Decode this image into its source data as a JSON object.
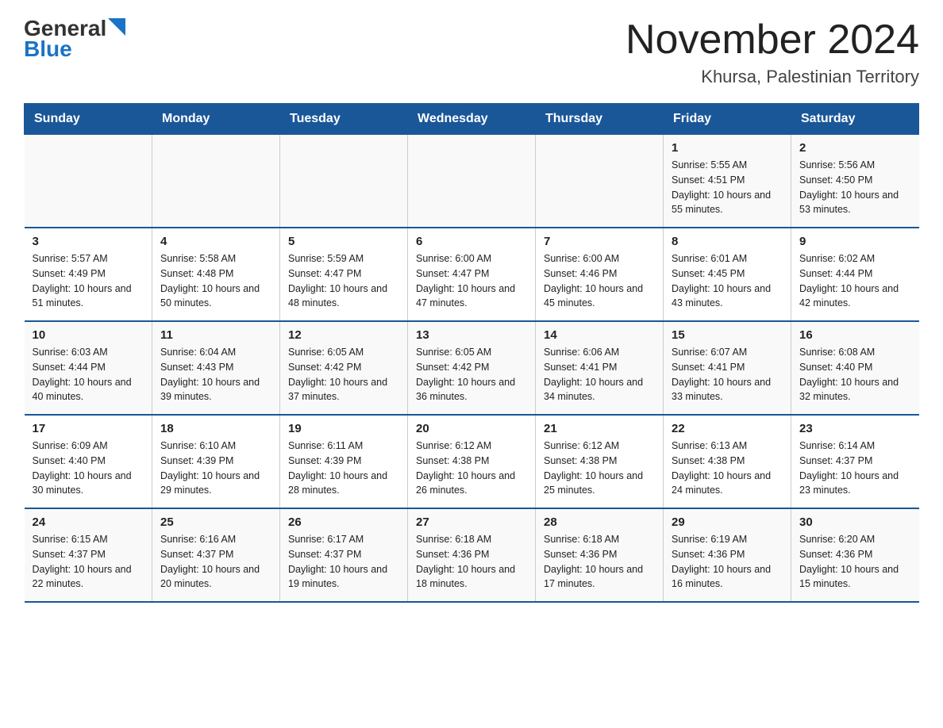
{
  "header": {
    "logo_line1": "General",
    "logo_line2": "Blue",
    "title": "November 2024",
    "subtitle": "Khursa, Palestinian Territory"
  },
  "days_of_week": [
    "Sunday",
    "Monday",
    "Tuesday",
    "Wednesday",
    "Thursday",
    "Friday",
    "Saturday"
  ],
  "weeks": [
    [
      {
        "day": "",
        "info": ""
      },
      {
        "day": "",
        "info": ""
      },
      {
        "day": "",
        "info": ""
      },
      {
        "day": "",
        "info": ""
      },
      {
        "day": "",
        "info": ""
      },
      {
        "day": "1",
        "info": "Sunrise: 5:55 AM\nSunset: 4:51 PM\nDaylight: 10 hours and 55 minutes."
      },
      {
        "day": "2",
        "info": "Sunrise: 5:56 AM\nSunset: 4:50 PM\nDaylight: 10 hours and 53 minutes."
      }
    ],
    [
      {
        "day": "3",
        "info": "Sunrise: 5:57 AM\nSunset: 4:49 PM\nDaylight: 10 hours and 51 minutes."
      },
      {
        "day": "4",
        "info": "Sunrise: 5:58 AM\nSunset: 4:48 PM\nDaylight: 10 hours and 50 minutes."
      },
      {
        "day": "5",
        "info": "Sunrise: 5:59 AM\nSunset: 4:47 PM\nDaylight: 10 hours and 48 minutes."
      },
      {
        "day": "6",
        "info": "Sunrise: 6:00 AM\nSunset: 4:47 PM\nDaylight: 10 hours and 47 minutes."
      },
      {
        "day": "7",
        "info": "Sunrise: 6:00 AM\nSunset: 4:46 PM\nDaylight: 10 hours and 45 minutes."
      },
      {
        "day": "8",
        "info": "Sunrise: 6:01 AM\nSunset: 4:45 PM\nDaylight: 10 hours and 43 minutes."
      },
      {
        "day": "9",
        "info": "Sunrise: 6:02 AM\nSunset: 4:44 PM\nDaylight: 10 hours and 42 minutes."
      }
    ],
    [
      {
        "day": "10",
        "info": "Sunrise: 6:03 AM\nSunset: 4:44 PM\nDaylight: 10 hours and 40 minutes."
      },
      {
        "day": "11",
        "info": "Sunrise: 6:04 AM\nSunset: 4:43 PM\nDaylight: 10 hours and 39 minutes."
      },
      {
        "day": "12",
        "info": "Sunrise: 6:05 AM\nSunset: 4:42 PM\nDaylight: 10 hours and 37 minutes."
      },
      {
        "day": "13",
        "info": "Sunrise: 6:05 AM\nSunset: 4:42 PM\nDaylight: 10 hours and 36 minutes."
      },
      {
        "day": "14",
        "info": "Sunrise: 6:06 AM\nSunset: 4:41 PM\nDaylight: 10 hours and 34 minutes."
      },
      {
        "day": "15",
        "info": "Sunrise: 6:07 AM\nSunset: 4:41 PM\nDaylight: 10 hours and 33 minutes."
      },
      {
        "day": "16",
        "info": "Sunrise: 6:08 AM\nSunset: 4:40 PM\nDaylight: 10 hours and 32 minutes."
      }
    ],
    [
      {
        "day": "17",
        "info": "Sunrise: 6:09 AM\nSunset: 4:40 PM\nDaylight: 10 hours and 30 minutes."
      },
      {
        "day": "18",
        "info": "Sunrise: 6:10 AM\nSunset: 4:39 PM\nDaylight: 10 hours and 29 minutes."
      },
      {
        "day": "19",
        "info": "Sunrise: 6:11 AM\nSunset: 4:39 PM\nDaylight: 10 hours and 28 minutes."
      },
      {
        "day": "20",
        "info": "Sunrise: 6:12 AM\nSunset: 4:38 PM\nDaylight: 10 hours and 26 minutes."
      },
      {
        "day": "21",
        "info": "Sunrise: 6:12 AM\nSunset: 4:38 PM\nDaylight: 10 hours and 25 minutes."
      },
      {
        "day": "22",
        "info": "Sunrise: 6:13 AM\nSunset: 4:38 PM\nDaylight: 10 hours and 24 minutes."
      },
      {
        "day": "23",
        "info": "Sunrise: 6:14 AM\nSunset: 4:37 PM\nDaylight: 10 hours and 23 minutes."
      }
    ],
    [
      {
        "day": "24",
        "info": "Sunrise: 6:15 AM\nSunset: 4:37 PM\nDaylight: 10 hours and 22 minutes."
      },
      {
        "day": "25",
        "info": "Sunrise: 6:16 AM\nSunset: 4:37 PM\nDaylight: 10 hours and 20 minutes."
      },
      {
        "day": "26",
        "info": "Sunrise: 6:17 AM\nSunset: 4:37 PM\nDaylight: 10 hours and 19 minutes."
      },
      {
        "day": "27",
        "info": "Sunrise: 6:18 AM\nSunset: 4:36 PM\nDaylight: 10 hours and 18 minutes."
      },
      {
        "day": "28",
        "info": "Sunrise: 6:18 AM\nSunset: 4:36 PM\nDaylight: 10 hours and 17 minutes."
      },
      {
        "day": "29",
        "info": "Sunrise: 6:19 AM\nSunset: 4:36 PM\nDaylight: 10 hours and 16 minutes."
      },
      {
        "day": "30",
        "info": "Sunrise: 6:20 AM\nSunset: 4:36 PM\nDaylight: 10 hours and 15 minutes."
      }
    ]
  ]
}
